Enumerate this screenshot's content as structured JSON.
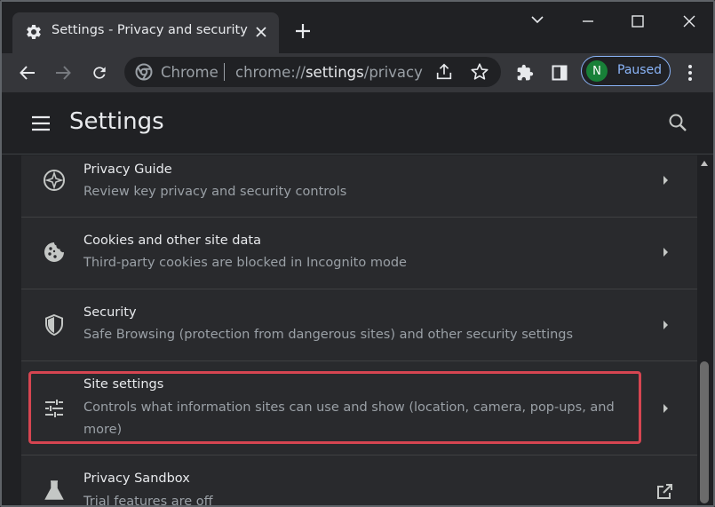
{
  "browser": {
    "tab_title": "Settings - Privacy and security",
    "omnibox": {
      "site_label": "Chrome",
      "url_prefix": "chrome://",
      "url_highlight": "settings",
      "url_suffix": "/privacy"
    },
    "profile": {
      "initial": "N",
      "status": "Paused",
      "avatar_color": "#188038"
    }
  },
  "settings": {
    "title": "Settings",
    "rows": [
      {
        "title": "Privacy Guide",
        "subtitle": "Review key privacy and security controls",
        "icon": "compass-icon"
      },
      {
        "title": "Cookies and other site data",
        "subtitle": "Third-party cookies are blocked in Incognito mode",
        "icon": "cookie-icon"
      },
      {
        "title": "Security",
        "subtitle": "Safe Browsing (protection from dangerous sites) and other security settings",
        "icon": "shield-icon"
      },
      {
        "title": "Site settings",
        "subtitle": "Controls what information sites can use and show (location, camera, pop-ups, and more)",
        "icon": "tune-icon"
      },
      {
        "title": "Privacy Sandbox",
        "subtitle": "Trial features are off",
        "icon": "flask-icon"
      }
    ]
  },
  "colors": {
    "highlight": "#d64551",
    "accent": "#8ab4f8"
  }
}
